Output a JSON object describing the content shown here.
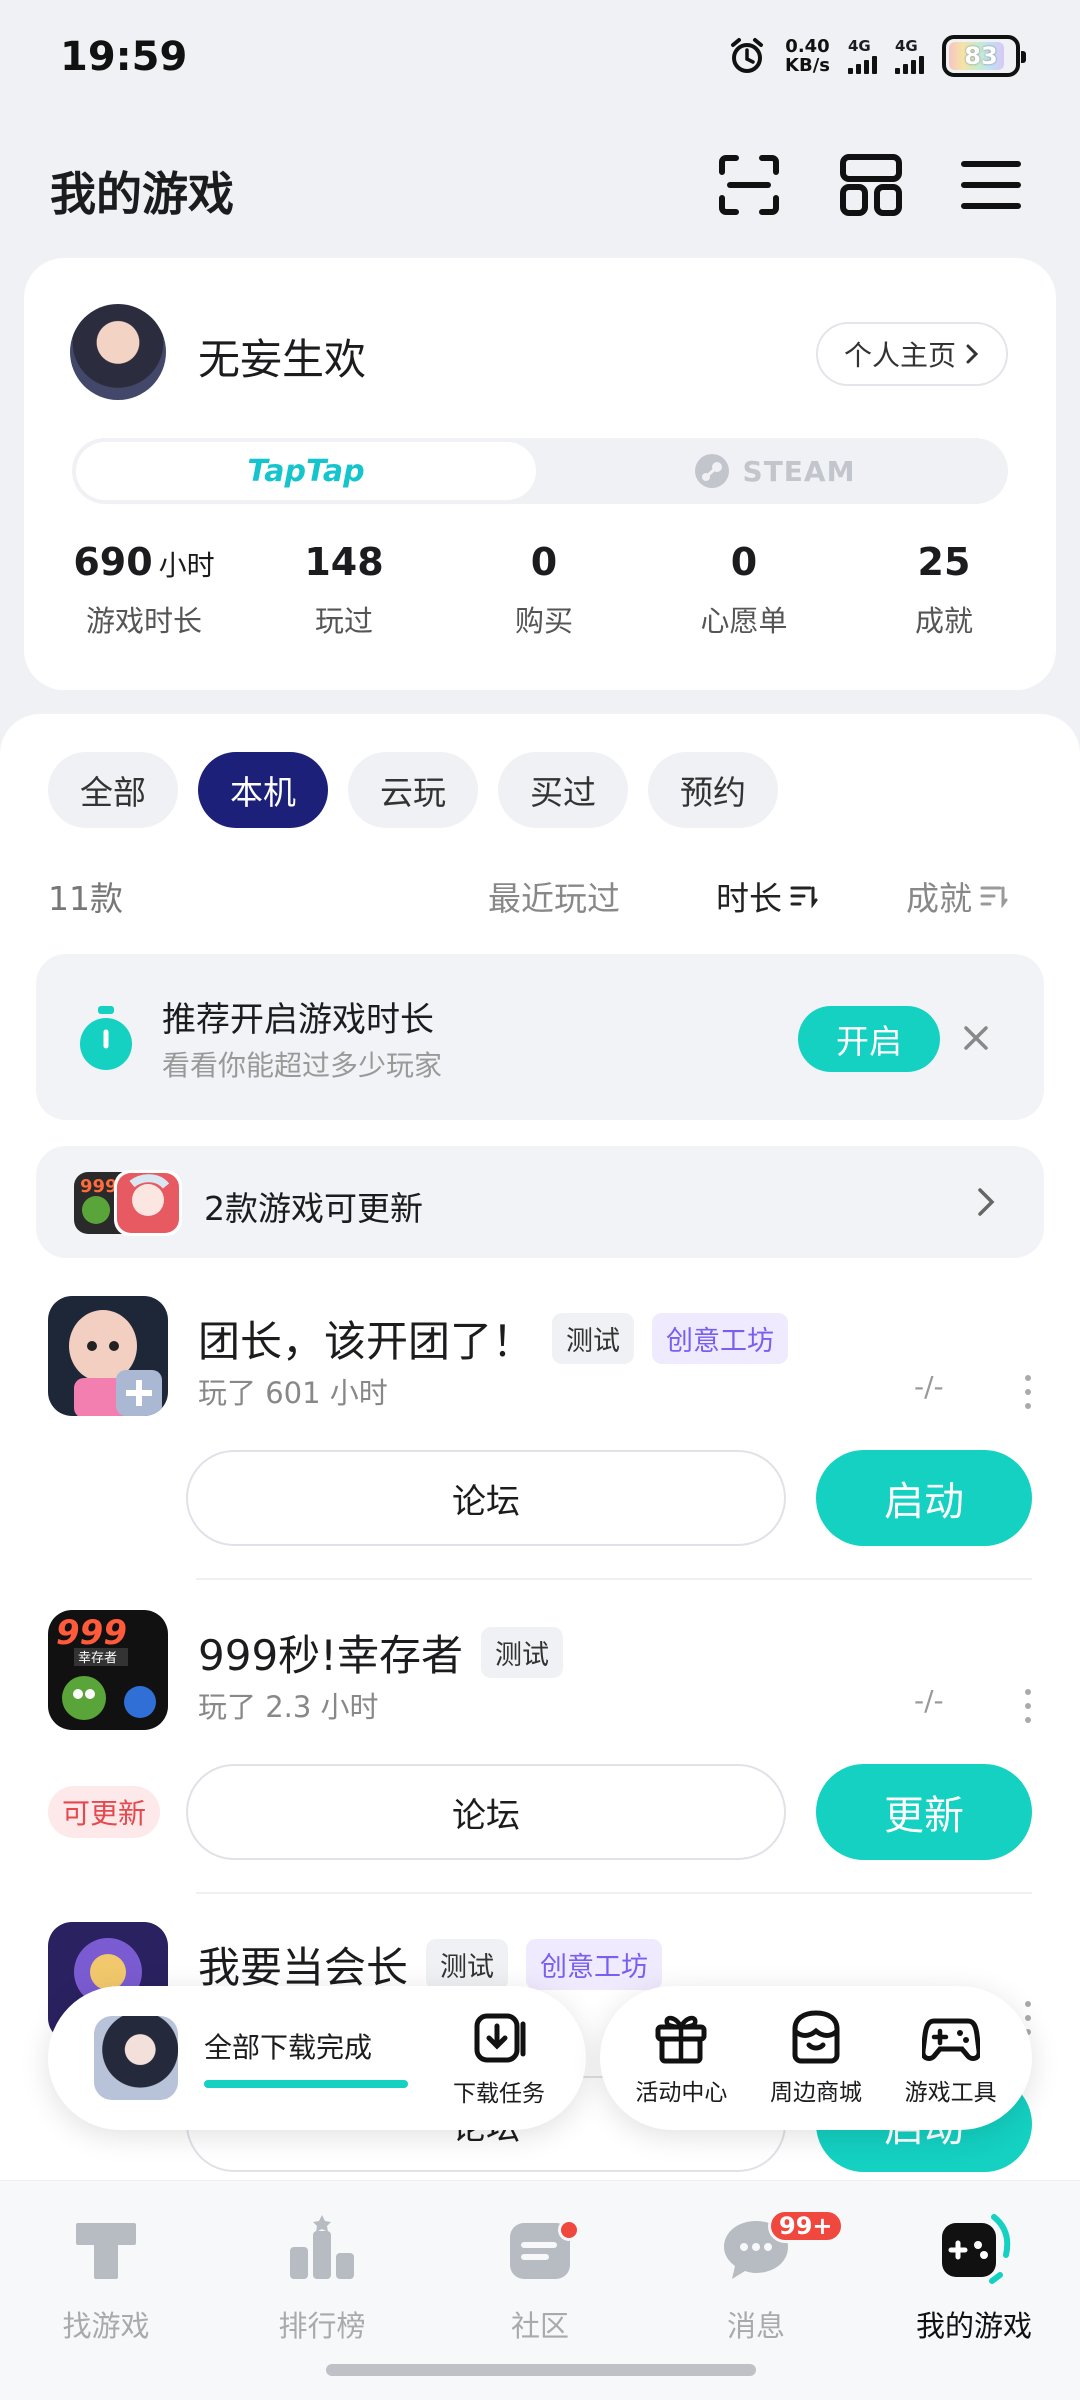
{
  "status_bar": {
    "time": "19:59",
    "speed_value": "0.40",
    "speed_unit": "KB/s",
    "sim1": "4G",
    "sim2": "4G",
    "battery": "83"
  },
  "header": {
    "title": "我的游戏"
  },
  "profile": {
    "username": "无妄生欢",
    "home_button": "个人主页",
    "platforms": [
      "TapTap",
      "STEAM"
    ],
    "stats": [
      {
        "value": "690",
        "unit": "小时",
        "label": "游戏时长"
      },
      {
        "value": "148",
        "unit": "",
        "label": "玩过"
      },
      {
        "value": "0",
        "unit": "",
        "label": "购买"
      },
      {
        "value": "0",
        "unit": "",
        "label": "心愿单"
      },
      {
        "value": "25",
        "unit": "",
        "label": "成就"
      }
    ]
  },
  "filters": [
    "全部",
    "本机",
    "云玩",
    "买过",
    "预约"
  ],
  "filter_active": "本机",
  "sortbar": {
    "count": "11款",
    "recent": "最近玩过",
    "duration": "时长",
    "achievement": "成就"
  },
  "tip": {
    "title": "推荐开启游戏时长",
    "subtitle": "看看你能超过多少玩家",
    "button": "开启"
  },
  "update_banner": {
    "text": "2款游戏可更新"
  },
  "games": [
    {
      "name": "团长，该开团了！",
      "tags": [
        "测试",
        "创意工坊"
      ],
      "played": "玩了 601 小时",
      "score": "-/-",
      "forum": "论坛",
      "action": "启动",
      "badge": ""
    },
    {
      "name": "999秒!幸存者",
      "tags": [
        "测试"
      ],
      "played": "玩了 2.3 小时",
      "score": "-/-",
      "forum": "论坛",
      "action": "更新",
      "badge": "可更新"
    },
    {
      "name": "我要当会长",
      "tags": [
        "测试",
        "创意工坊"
      ],
      "played": "",
      "score": "",
      "forum": "论坛",
      "action": "启动",
      "badge": ""
    }
  ],
  "download": {
    "text": "全部下载完成",
    "progress": 1.0,
    "task_label": "下载任务"
  },
  "tools": [
    "活动中心",
    "周边商城",
    "游戏工具"
  ],
  "nav": [
    {
      "label": "找游戏",
      "icon": "tap-icon"
    },
    {
      "label": "排行榜",
      "icon": "ranking-icon"
    },
    {
      "label": "社区",
      "icon": "community-icon"
    },
    {
      "label": "消息",
      "icon": "message-icon",
      "badge": "99+"
    },
    {
      "label": "我的游戏",
      "icon": "my-games-icon"
    }
  ],
  "colors": {
    "accent": "#14d1c2",
    "active_chip": "#1c2078",
    "badge_red": "#f0483e",
    "tag_purple": "#7a5ef0"
  }
}
